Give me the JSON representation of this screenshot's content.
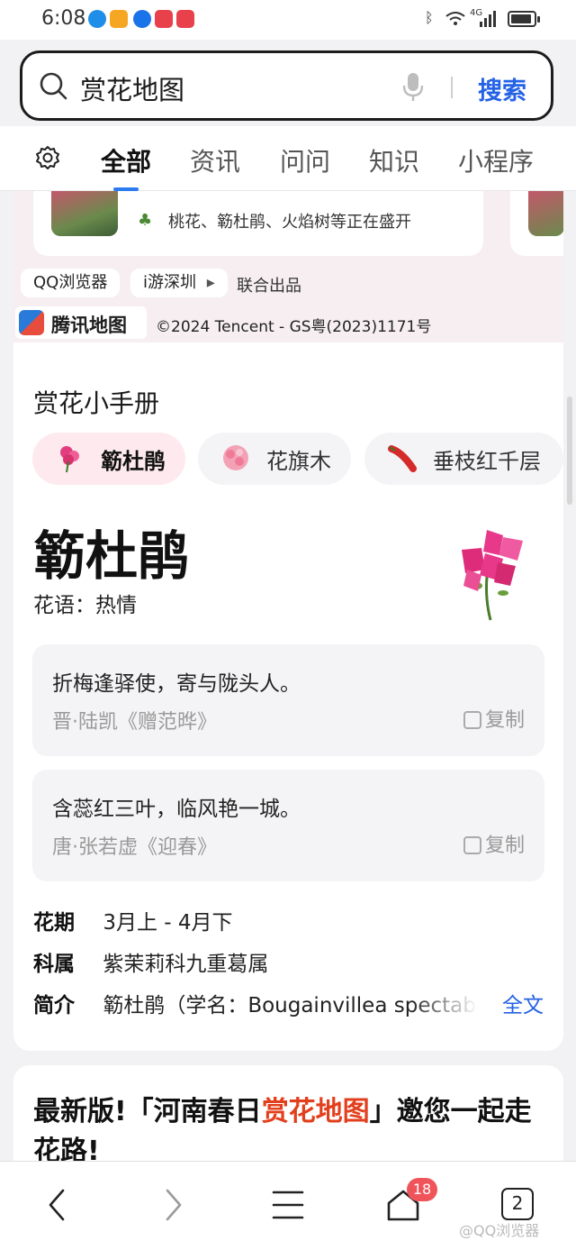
{
  "status_bar": {
    "time": "6:08",
    "network": "4G",
    "app_icon_colors": [
      "#1f8ee8",
      "#f5a623",
      "#1a73e8",
      "#e8414b",
      "#e8414b"
    ]
  },
  "search": {
    "query": "赏花地图",
    "button_label": "搜索"
  },
  "tabs": {
    "items": [
      "全部",
      "资讯",
      "问问",
      "知识",
      "小程序"
    ],
    "active": "全部"
  },
  "map": {
    "card_tip": "桃花、簕杜鹃、火焰树等正在盛开",
    "chip_browser": "QQ浏览器",
    "chip_city": "i游深圳",
    "chip_city_arrow": "▸",
    "credit_text": "联合出品",
    "logo_text": "腾讯地图",
    "copyright": "©2024 Tencent - GS粤(2023)1171号"
  },
  "handbook": {
    "heading": "赏花小手册",
    "flowers": [
      {
        "label": "簕杜鹃",
        "selected": true
      },
      {
        "label": "花旗木",
        "selected": false
      },
      {
        "label": "垂枝红千层",
        "selected": false
      }
    ],
    "flower_name": "簕杜鹃",
    "flower_meaning": "花语：热情",
    "poems": [
      {
        "line": "折梅逢驿使，寄与陇头人。",
        "author": "晋·陆凯《赠范晔》",
        "copy_label": "复制"
      },
      {
        "line": "含蕊红三叶，临风艳一城。",
        "author": "唐·张若虚《迎春》",
        "copy_label": "复制"
      }
    ],
    "info": {
      "season_key": "花期",
      "season_value": "3月上 - 4月下",
      "family_key": "科属",
      "family_value": "紫茉莉科九重葛属",
      "intro_key": "简介",
      "intro_value": "簕杜鹃（学名：Bougainvillea spectab",
      "more_label": "全文"
    }
  },
  "news": {
    "title_before": "最新版!「河南春日",
    "title_highlight": "赏花地图",
    "title_after": "」邀您一起走花路!"
  },
  "bottom_nav": {
    "home_badge": "18",
    "tab_count": "2",
    "watermark": "@QQ浏览器"
  },
  "colors": {
    "accent": "#2462e6",
    "highlight": "#e23f1c",
    "badge": "#f0545b",
    "selected_pill": "#fde9ee"
  }
}
